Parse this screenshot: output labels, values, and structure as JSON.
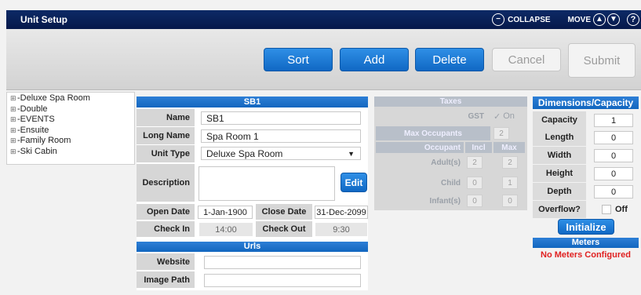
{
  "header": {
    "title": "Unit Setup",
    "collapse_label": "COLLAPSE",
    "move_label": "MOVE",
    "help": "?"
  },
  "toolbar": {
    "sort": "Sort",
    "add": "Add",
    "delete": "Delete",
    "cancel": "Cancel",
    "submit": "Submit"
  },
  "tree": {
    "items": [
      "Deluxe Spa Room",
      "Double",
      "EVENTS",
      "Ensuite",
      "Family Room",
      "Ski Cabin"
    ]
  },
  "unit": {
    "header": "SB1",
    "name_label": "Name",
    "name": "SB1",
    "long_name_label": "Long Name",
    "long_name": "Spa Room 1",
    "unit_type_label": "Unit Type",
    "unit_type": "Deluxe Spa Room",
    "description_label": "Description",
    "description": "",
    "edit_label": "Edit",
    "open_date_label": "Open Date",
    "open_date": "1-Jan-1900",
    "close_date_label": "Close Date",
    "close_date": "31-Dec-2099",
    "check_in_label": "Check In",
    "check_in": "14:00",
    "check_out_label": "Check Out",
    "check_out": "9:30"
  },
  "urls": {
    "header": "Urls",
    "website_label": "Website",
    "website": "",
    "image_path_label": "Image Path",
    "image_path": ""
  },
  "taxes": {
    "header": "Taxes",
    "gst_label": "GST",
    "gst_value": "On",
    "max_occupants_label": "Max Occupants",
    "max_occupants": "2",
    "col_occupant": "Occupant",
    "col_incl": "Incl",
    "col_max": "Max",
    "rows": [
      {
        "label": "Adult(s)",
        "incl": "2",
        "max": "2"
      },
      {
        "label": "Child",
        "incl": "0",
        "max": "1"
      },
      {
        "label": "Infant(s)",
        "incl": "0",
        "max": "0"
      }
    ]
  },
  "dimensions": {
    "header": "Dimensions/Capacity",
    "capacity_label": "Capacity",
    "capacity": "1",
    "length_label": "Length",
    "length": "0",
    "width_label": "Width",
    "width": "0",
    "height_label": "Height",
    "height": "0",
    "depth_label": "Depth",
    "depth": "0",
    "overflow_label": "Overflow?",
    "overflow_value": "Off",
    "initialize_label": "Initialize",
    "meters_header": "Meters",
    "meters_status": "No Meters Configured"
  },
  "colors": {
    "accent": "#1a72cc",
    "title_bar": "#0a2259",
    "error": "#e02020"
  }
}
